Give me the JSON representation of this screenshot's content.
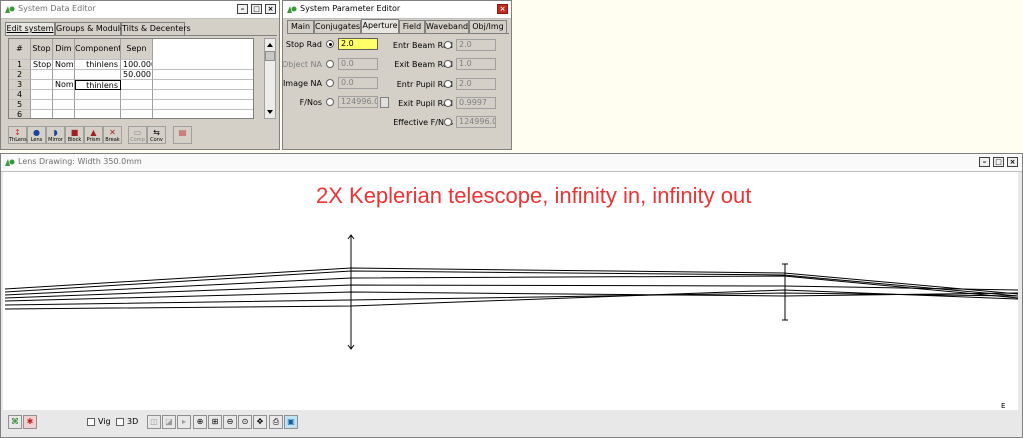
{
  "sde": {
    "title": "System Data Editor",
    "tabs": [
      "Edit system",
      "Groups & Modules",
      "Tilts & Decenters"
    ],
    "columns": [
      "#",
      "Stop",
      "Dim",
      "Component",
      "Sepn"
    ],
    "rows": [
      {
        "num": "1",
        "stop": "Stop",
        "dim": "Nom",
        "component": "thinlens",
        "sepn": "100.000"
      },
      {
        "num": "2",
        "stop": "",
        "dim": "",
        "component": "",
        "sepn": "50.000"
      },
      {
        "num": "3",
        "stop": "",
        "dim": "Nom",
        "component": "thinlens",
        "sepn": ""
      },
      {
        "num": "4",
        "stop": "",
        "dim": "",
        "component": "",
        "sepn": ""
      },
      {
        "num": "5",
        "stop": "",
        "dim": "",
        "component": "",
        "sepn": ""
      },
      {
        "num": "6",
        "stop": "",
        "dim": "",
        "component": "",
        "sepn": ""
      }
    ],
    "tools": [
      "ThLens",
      "Lens",
      "Mirror",
      "Block",
      "Prism",
      "Break",
      "Comp",
      "Conv"
    ]
  },
  "spe": {
    "title": "System Parameter Editor",
    "tabs": [
      "Main",
      "Conjugates",
      "Aperture",
      "Field",
      "Waveband",
      "Obj/Img"
    ],
    "left": [
      {
        "label": "Stop Rad",
        "value": "2.0",
        "selected": true,
        "disabled": false
      },
      {
        "label": "Object NA",
        "value": "0.0",
        "selected": false,
        "disabled": true
      },
      {
        "label": "Image NA",
        "value": "0.0",
        "selected": false,
        "disabled": false
      },
      {
        "label": "F/Nos",
        "value": "124996.0",
        "selected": false,
        "disabled": false
      }
    ],
    "right": [
      {
        "label": "Entr Beam Rad",
        "value": "2.0"
      },
      {
        "label": "Exit Beam Rad",
        "value": "1.0"
      },
      {
        "label": "Entr Pupil Rad",
        "value": "2.0"
      },
      {
        "label": "Exit Pupil Rad",
        "value": "0.9997"
      },
      {
        "label": "Effective F/Nos",
        "value": "124996.0"
      }
    ]
  },
  "lens": {
    "title": "Lens Drawing: Width  350.0mm",
    "annotation": "2X Keplerian telescope, infinity in, infinity out",
    "annotation_color": "#ee3333",
    "corner_label": "E",
    "vig_label": "Vig",
    "three_d_label": "3D"
  }
}
